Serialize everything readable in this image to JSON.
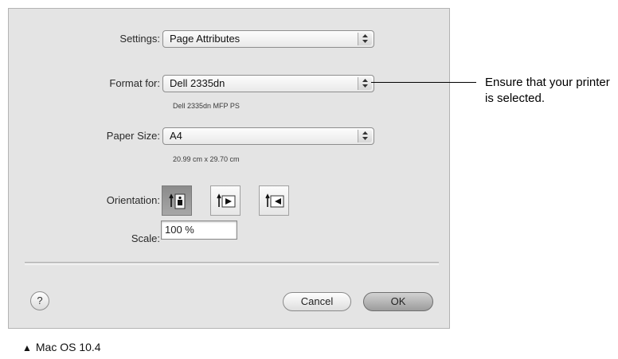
{
  "dialog": {
    "settings": {
      "label": "Settings:",
      "value": "Page Attributes"
    },
    "format_for": {
      "label": "Format for:",
      "value": "Dell 2335dn",
      "subtext": "Dell 2335dn MFP PS"
    },
    "paper_size": {
      "label": "Paper Size:",
      "value": "A4",
      "subtext": "20.99 cm x 29.70 cm"
    },
    "orientation": {
      "label": "Orientation:",
      "selected": "portrait",
      "options": [
        "portrait",
        "landscape-left",
        "landscape-right"
      ]
    },
    "scale": {
      "label": "Scale:",
      "value": "100 %"
    },
    "help_label": "?",
    "cancel_label": "Cancel",
    "ok_label": "OK"
  },
  "callout": {
    "text": "Ensure that your printer is selected."
  },
  "caption": {
    "symbol": "▲",
    "text": "Mac OS 10.4"
  },
  "icons": {
    "popup_arrows": "up-down-arrows-icon",
    "portrait": "portrait-orientation-icon",
    "landscape_left": "landscape-left-orientation-icon",
    "landscape_right": "landscape-right-orientation-icon",
    "help": "help-icon"
  }
}
